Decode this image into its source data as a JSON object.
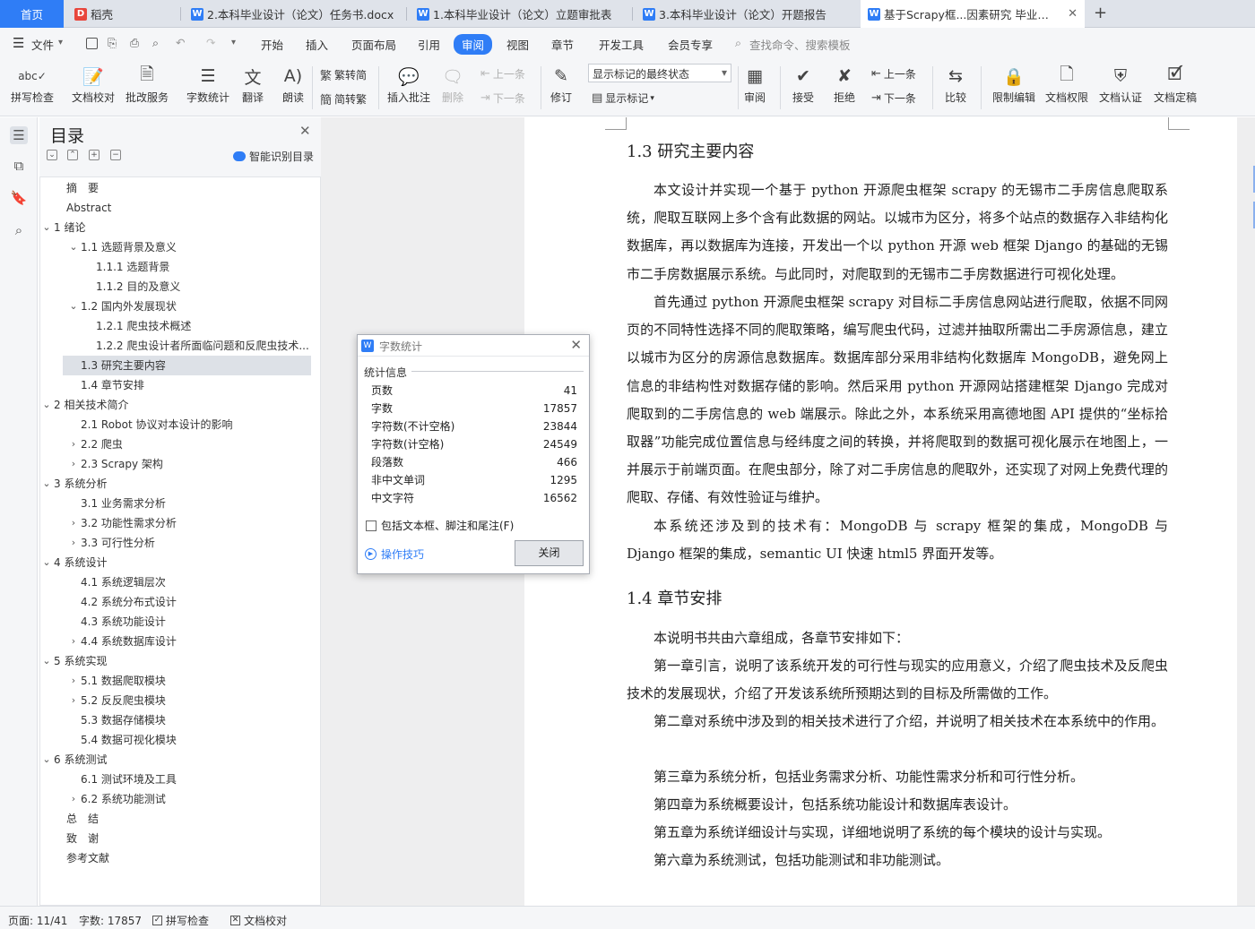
{
  "tabs": [
    {
      "label": "首页"
    },
    {
      "label": "稻壳"
    },
    {
      "label": "2.本科毕业设计（论文）任务书.docx"
    },
    {
      "label": "1.本科毕业设计（论文）立题审批表"
    },
    {
      "label": "3.本科毕业设计（论文）开题报告"
    },
    {
      "label": "基于Scrapy框...因素研究 毕业论文"
    }
  ],
  "menu": {
    "file": "文件",
    "items": [
      "开始",
      "插入",
      "页面布局",
      "引用",
      "审阅",
      "视图",
      "章节",
      "开发工具",
      "会员专享"
    ],
    "search_placeholder": "查找命令、搜索模板"
  },
  "ribbon": {
    "spell_check": "拼写检查",
    "doc_proof": "文档校对",
    "revision_service": "批改服务",
    "word_count": "字数统计",
    "translate": "翻译",
    "read_aloud": "朗读",
    "to_traditional": "繁转简",
    "to_simplified": "简转繁",
    "insert_comment": "插入批注",
    "delete": "删除",
    "prev_comment": "上一条",
    "next_comment": "下一条",
    "track": "修订",
    "markup_mode": "显示标记的最终状态",
    "show_markup": "显示标记",
    "review": "审阅",
    "accept": "接受",
    "reject": "拒绝",
    "prev_change": "上一条",
    "next_change": "下一条",
    "compare": "比较",
    "restrict_edit": "限制编辑",
    "doc_permission": "文档权限",
    "doc_auth": "文档认证",
    "doc_finalize": "文档定稿"
  },
  "nav": {
    "title": "目录",
    "smart_toc": "智能识别目录",
    "items": [
      {
        "label": "摘　要"
      },
      {
        "label": "Abstract"
      },
      {
        "label": "1  绪论"
      },
      {
        "label": "1.1  选题背景及意义"
      },
      {
        "label": "1.1.1 选题背景"
      },
      {
        "label": "1.1.2 目的及意义"
      },
      {
        "label": "1.2  国内外发展现状"
      },
      {
        "label": "1.2.1  爬虫技术概述"
      },
      {
        "label": "1.2.2  爬虫设计者所面临问题和反爬虫技术..."
      },
      {
        "label": "1.3  研究主要内容"
      },
      {
        "label": "1.4  章节安排"
      },
      {
        "label": "2  相关技术简介"
      },
      {
        "label": "2.1 Robot 协议对本设计的影响"
      },
      {
        "label": "2.2  爬虫"
      },
      {
        "label": "2.3 Scrapy 架构"
      },
      {
        "label": "3  系统分析"
      },
      {
        "label": "3.1  业务需求分析"
      },
      {
        "label": "3.2  功能性需求分析"
      },
      {
        "label": "3.3  可行性分析"
      },
      {
        "label": "4  系统设计"
      },
      {
        "label": "4.1  系统逻辑层次"
      },
      {
        "label": "4.2  系统分布式设计"
      },
      {
        "label": "4.3  系统功能设计"
      },
      {
        "label": "4.4  系统数据库设计"
      },
      {
        "label": "5  系统实现"
      },
      {
        "label": "5.1  数据爬取模块"
      },
      {
        "label": "5.2  反反爬虫模块"
      },
      {
        "label": "5.3  数据存储模块"
      },
      {
        "label": "5.4  数据可视化模块"
      },
      {
        "label": "6  系统测试"
      },
      {
        "label": "6.1  测试环境及工具"
      },
      {
        "label": "6.2  系统功能测试"
      },
      {
        "label": "总　结"
      },
      {
        "label": "致　谢"
      },
      {
        "label": "参考文献"
      }
    ]
  },
  "document": {
    "h13": "1.3  研究主要内容",
    "p1": "本文设计并实现一个基于 python 开源爬虫框架 scrapy 的无锡市二手房信息爬取系统，爬取互联网上多个含有此数据的网站。以城市为区分，将多个站点的数据存入非结构化数据库，再以数据库为连接，开发出一个以 python 开源 web 框架 Django 的基础的无锡市二手房数据展示系统。与此同时，对爬取到的无锡市二手房数据进行可视化处理。",
    "p2": "首先通过 python 开源爬虫框架 scrapy 对目标二手房信息网站进行爬取，依据不同网页的不同特性选择不同的爬取策略，编写爬虫代码，过滤并抽取所需出二手房源信息，建立以城市为区分的房源信息数据库。数据库部分采用非结构化数据库 MongoDB，避免网上信息的非结构性对数据存储的影响。然后采用 python 开源网站搭建框架 Django 完成对爬取到的二手房信息的 web 端展示。除此之外，本系统采用高德地图 API 提供的“坐标拾取器”功能完成位置信息与经纬度之间的转换，并将爬取到的数据可视化展示在地图上，一并展示于前端页面。在爬虫部分，除了对二手房信息的爬取外，还实现了对网上免费代理的爬取、存储、有效性验证与维护。",
    "p3": "本系统还涉及到的技术有：MongoDB 与 scrapy 框架的集成，MongoDB 与 Django 框架的集成，semantic UI 快速 html5 界面开发等。",
    "h14": "1.4  章节安排",
    "p4": "本说明书共由六章组成，各章节安排如下：",
    "p5": "第一章引言，说明了该系统开发的可行性与现实的应用意义，介绍了爬虫技术及反爬虫技术的发展现状，介绍了开发该系统所预期达到的目标及所需做的工作。",
    "p6": "第二章对系统中涉及到的相关技术进行了介绍，并说明了相关技术在本系统中的作用。",
    "p7": "第三章为系统分析，包括业务需求分析、功能性需求分析和可行性分析。",
    "p8": "第四章为系统概要设计，包括系统功能设计和数据库表设计。",
    "p9": "第五章为系统详细设计与实现，详细地说明了系统的每个模块的设计与实现。",
    "p10": "第六章为系统测试，包括功能测试和非功能测试。"
  },
  "dialog": {
    "title": "字数统计",
    "section": "统计信息",
    "rows": [
      {
        "label": "页数",
        "value": "41"
      },
      {
        "label": "字数",
        "value": "17857"
      },
      {
        "label": "字符数(不计空格)",
        "value": "23844"
      },
      {
        "label": "字符数(计空格)",
        "value": "24549"
      },
      {
        "label": "段落数",
        "value": "466"
      },
      {
        "label": "非中文单词",
        "value": "1295"
      },
      {
        "label": "中文字符",
        "value": "16562"
      }
    ],
    "checkbox": "包括文本框、脚注和尾注(F)",
    "tips": "操作技巧",
    "close": "关闭"
  },
  "status": {
    "page": "页面: 11/41",
    "words": "字数: 17857",
    "spell": "拼写检查",
    "proof": "文档校对"
  },
  "colors": {
    "accent": "#2f7df6",
    "wps_red": "#e8463c"
  }
}
